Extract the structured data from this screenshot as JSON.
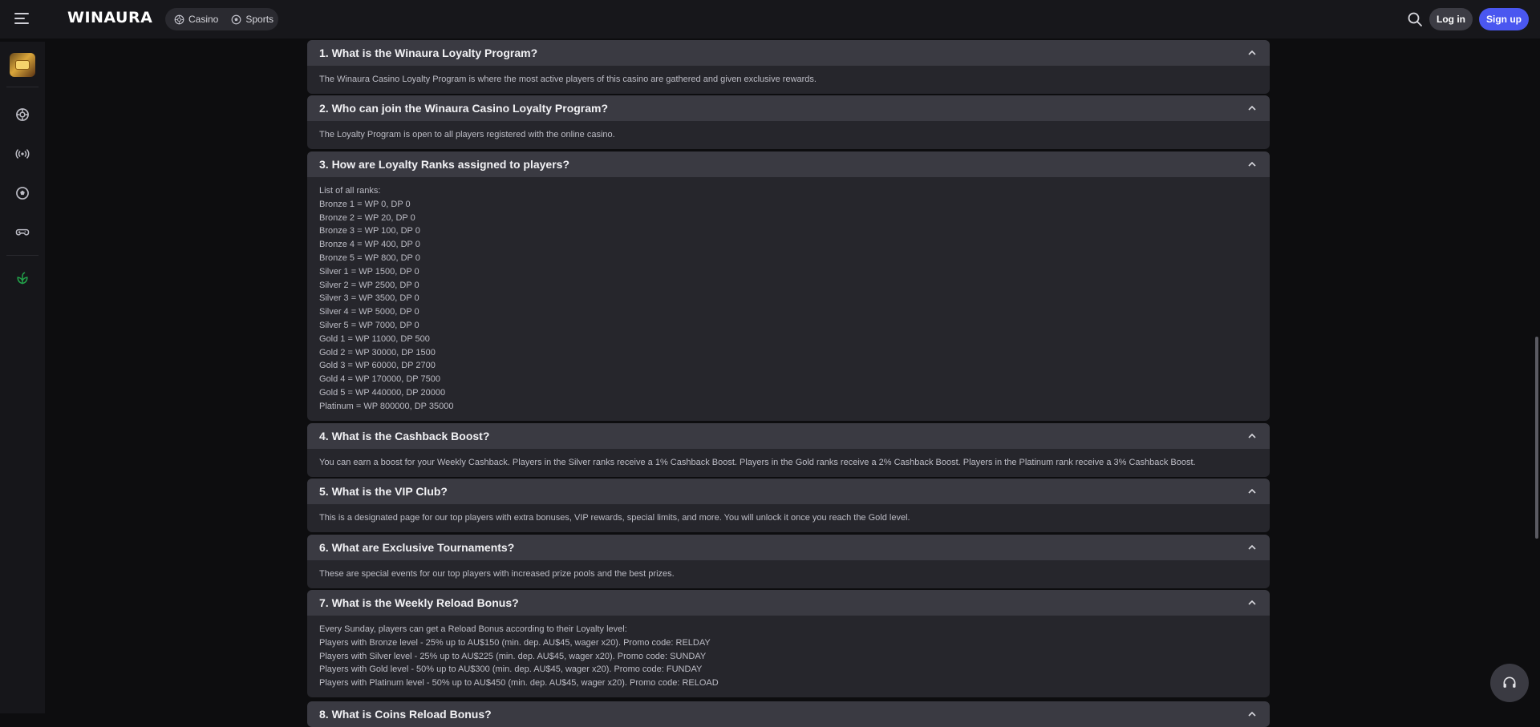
{
  "header": {
    "logo": "WINAURA",
    "nav": [
      {
        "label": "Casino",
        "icon": "casino-chip-icon"
      },
      {
        "label": "Sports",
        "icon": "football-icon"
      }
    ],
    "login_label": "Log in",
    "signup_label": "Sign up",
    "accent_color": "#4a57f0"
  },
  "sidebar": {
    "icons": [
      "promo-thumbnail",
      "casino-chip-icon",
      "live-broadcast-icon",
      "football-icon",
      "gamepad-icon",
      "leaf-icon"
    ],
    "accent_color": "#22a24a"
  },
  "faq": [
    {
      "title": "1. What is the Winaura Loyalty Program?",
      "lines": [
        "The Winaura Casino Loyalty Program is where the most active players of this casino are gathered and given exclusive rewards."
      ]
    },
    {
      "title": "2. Who can join the Winaura Casino Loyalty Program?",
      "lines": [
        "The Loyalty Program is open to all players registered with the online casino."
      ]
    },
    {
      "title": "3. How are Loyalty Ranks assigned to players?",
      "lines": [
        "List of all ranks:",
        "Bronze 1 = WP 0, DP 0",
        "Bronze 2 = WP 20, DP 0",
        "Bronze 3 = WP 100, DP 0",
        "Bronze 4 = WP 400, DP 0",
        "Bronze 5 = WP 800, DP 0",
        "Silver 1 = WP 1500, DP 0",
        "Silver 2 = WP 2500, DP 0",
        "Silver 3 = WP 3500, DP 0",
        "Silver 4 = WP 5000, DP 0",
        "Silver 5 = WP 7000, DP 0",
        "Gold 1 = WP 11000, DP 500",
        "Gold 2 = WP 30000, DP 1500",
        "Gold 3 = WP 60000, DP 2700",
        "Gold 4 = WP 170000, DP 7500",
        "Gold 5 = WP 440000, DP 20000",
        "Platinum = WP 800000, DP 35000"
      ]
    },
    {
      "title": "4. What is the Cashback Boost?",
      "lines": [
        "You can earn a boost for your Weekly Cashback. Players in the Silver ranks receive a 1% Cashback Boost. Players in the Gold ranks receive a 2% Cashback Boost. Players in the Platinum rank receive a 3% Cashback Boost."
      ]
    },
    {
      "title": "5. What is the VIP Club?",
      "lines": [
        "This is a designated page for our top players with extra bonuses, VIP rewards, special limits, and more. You will unlock it once you reach the Gold level."
      ]
    },
    {
      "title": "6. What are Exclusive Tournaments?",
      "lines": [
        "These are special events for our top players with increased prize pools and the best prizes."
      ]
    },
    {
      "title": "7. What is the Weekly Reload Bonus?",
      "lines": [
        "Every Sunday, players can get a Reload Bonus according to their Loyalty level:",
        "Players with Bronze level - 25% up to AU$150 (min. dep. AU$45, wager x20). Promo code: RELDAY",
        "Players with Silver level - 25% up to AU$225 (min. dep. AU$45, wager x20). Promo code: SUNDAY",
        "Players with Gold level - 50% up to AU$300 (min. dep. AU$45, wager x20). Promo code: FUNDAY",
        "Players with Platinum level - 50% up to AU$450 (min. dep. AU$45, wager x20). Promo code: RELOAD"
      ]
    },
    {
      "title": "8. What is Coins Reload Bonus?",
      "lines": []
    }
  ]
}
